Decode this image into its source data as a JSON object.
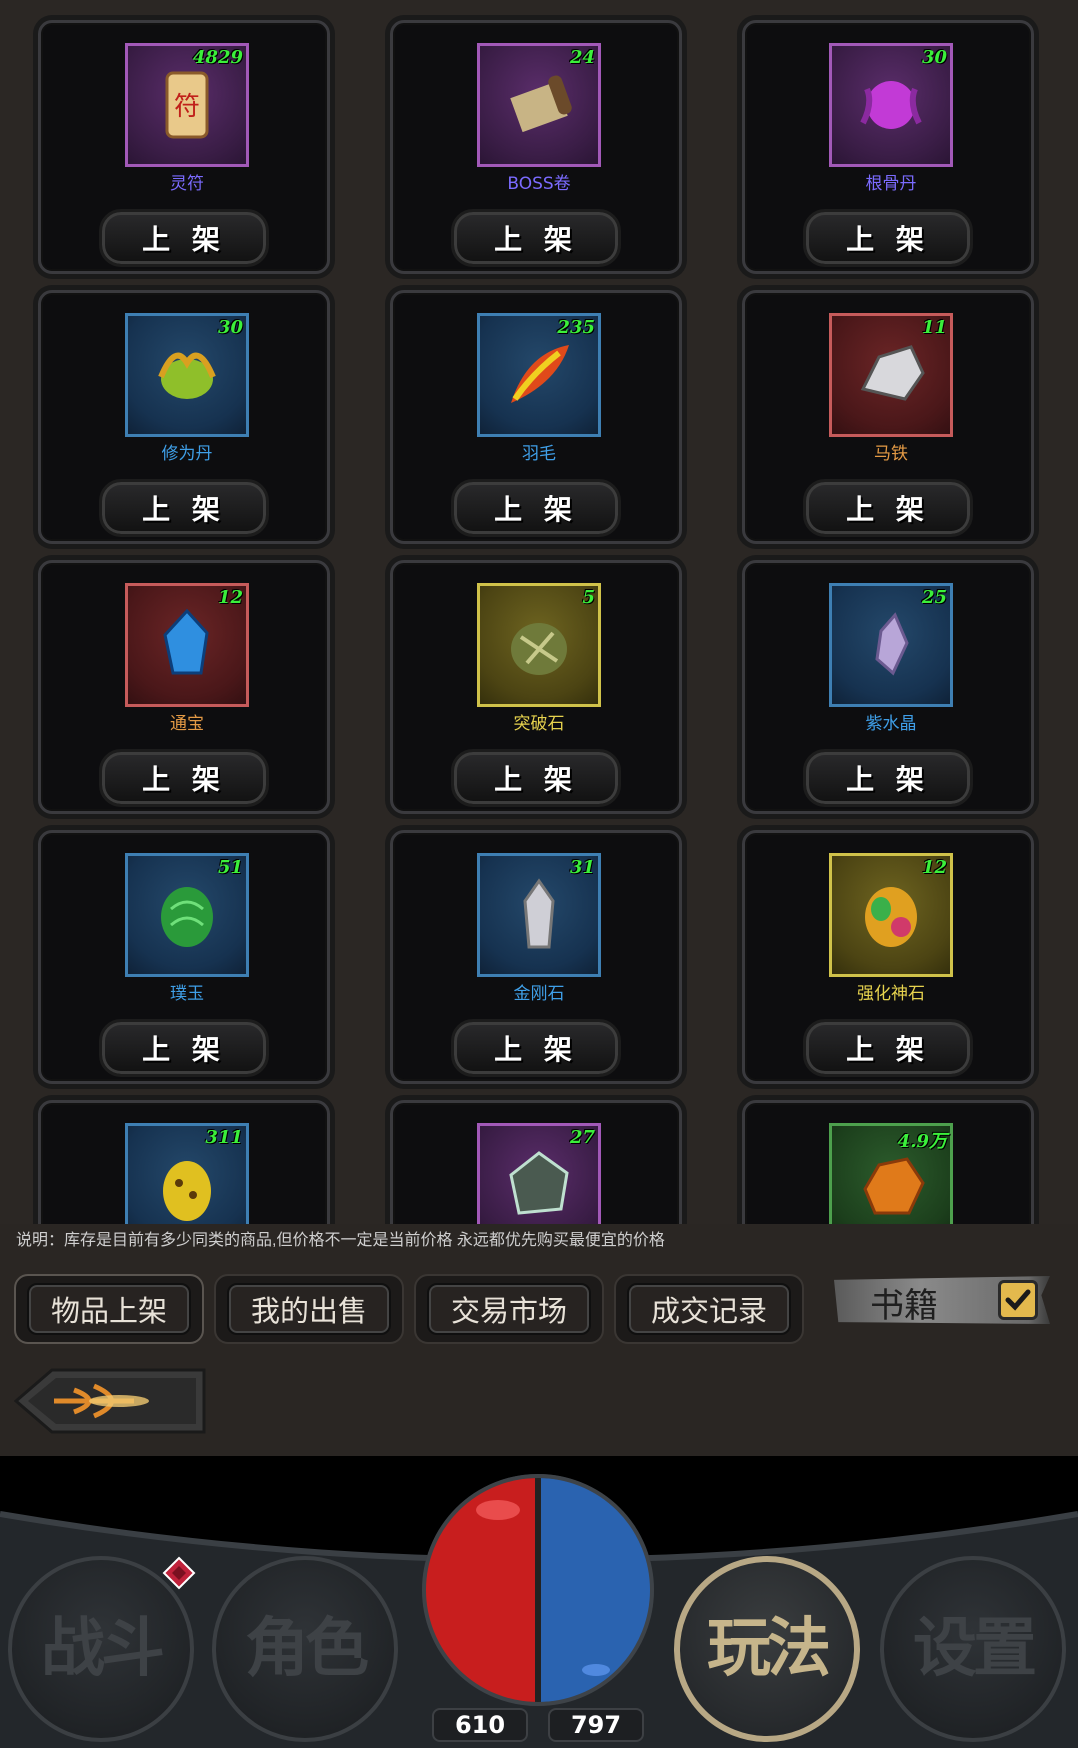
{
  "items": [
    {
      "name": "灵符",
      "count": "4829",
      "rarity": "purple",
      "name_color": "#7b6bff",
      "icon": "talisman-scroll-icon"
    },
    {
      "name": "BOSS卷",
      "count": "24",
      "rarity": "purple",
      "name_color": "#7b6bff",
      "icon": "boss-scroll-icon"
    },
    {
      "name": "根骨丹",
      "count": "30",
      "rarity": "purple",
      "name_color": "#7b6bff",
      "icon": "purple-orb-icon"
    },
    {
      "name": "修为丹",
      "count": "30",
      "rarity": "blue",
      "name_color": "#3f9fe8",
      "icon": "golden-pill-icon"
    },
    {
      "name": "羽毛",
      "count": "235",
      "rarity": "blue",
      "name_color": "#3f9fe8",
      "icon": "feather-icon"
    },
    {
      "name": "马铁",
      "count": "11",
      "rarity": "red",
      "name_color": "#e49a45",
      "icon": "iron-ore-icon"
    },
    {
      "name": "通宝",
      "count": "12",
      "rarity": "red",
      "name_color": "#e49a45",
      "icon": "blue-crystal-icon"
    },
    {
      "name": "突破石",
      "count": "5",
      "rarity": "gold",
      "name_color": "#e6d24e",
      "icon": "breakthrough-stone-icon"
    },
    {
      "name": "紫水晶",
      "count": "25",
      "rarity": "blue",
      "name_color": "#3f9fe8",
      "icon": "amethyst-icon"
    },
    {
      "name": "璞玉",
      "count": "51",
      "rarity": "blue",
      "name_color": "#3f9fe8",
      "icon": "green-jade-icon"
    },
    {
      "name": "金刚石",
      "count": "31",
      "rarity": "blue",
      "name_color": "#3f9fe8",
      "icon": "diamond-icon"
    },
    {
      "name": "强化神石",
      "count": "12",
      "rarity": "gold",
      "name_color": "#e6d24e",
      "icon": "rainbow-stone-icon"
    },
    {
      "name": "",
      "count": "311",
      "rarity": "blue",
      "name_color": "#3f9fe8",
      "icon": "yellow-seed-icon"
    },
    {
      "name": "",
      "count": "27",
      "rarity": "purple",
      "name_color": "#7b6bff",
      "icon": "dark-gem-icon"
    },
    {
      "name": "",
      "count": "4.9万",
      "rarity": "green",
      "name_color": "#4da04d",
      "icon": "amber-ore-icon"
    }
  ],
  "list_button_label": "上 架",
  "notice": "说明：库存是目前有多少同类的商品,但价格不一定是当前价格 永远都优先购买最便宜的价格",
  "tabs": [
    {
      "label": "物品上架",
      "active": true
    },
    {
      "label": "我的出售",
      "active": false
    },
    {
      "label": "交易市场",
      "active": false
    },
    {
      "label": "成交记录",
      "active": false
    }
  ],
  "filter": {
    "label": "书籍",
    "checked": true,
    "check_icon": "checkmark-icon"
  },
  "back_icon": "arrow-back-icon",
  "bottom_nav": [
    {
      "label": "战斗",
      "active": false
    },
    {
      "label": "角色",
      "active": false
    },
    {
      "label": "玩法",
      "active": true
    },
    {
      "label": "设置",
      "active": false
    }
  ],
  "hp_value": "610",
  "mp_value": "797",
  "colors": {
    "hp": "#c81e1e",
    "mp": "#2a63b0",
    "accent": "#b8a885"
  }
}
